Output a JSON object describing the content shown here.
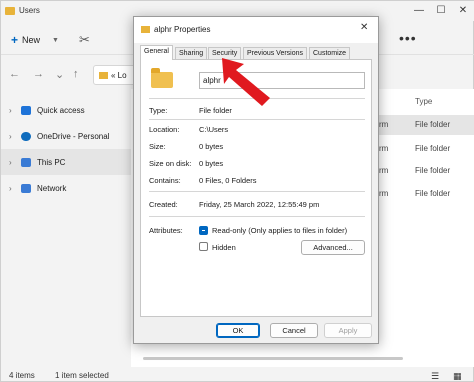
{
  "explorer": {
    "title": "Users",
    "toolbar": {
      "new_label": "New"
    },
    "address_text": "« Lo",
    "sidebar": [
      {
        "label": "Quick access",
        "icon": "star-icon",
        "color": "#1e73d8"
      },
      {
        "label": "OneDrive - Personal",
        "icon": "cloud-icon",
        "color": "#0f6cbd"
      },
      {
        "label": "This PC",
        "icon": "computer-icon",
        "color": "#3a7bd5",
        "selected": true
      },
      {
        "label": "Network",
        "icon": "network-icon",
        "color": "#3a7bd5"
      }
    ],
    "column_header": "Type",
    "rows": [
      {
        "left": "rm",
        "type": "File folder"
      },
      {
        "left": "rm",
        "type": "File folder"
      },
      {
        "left": "rm",
        "type": "File folder"
      },
      {
        "left": "rm",
        "type": "File folder"
      }
    ],
    "status": {
      "items": "4 items",
      "selected": "1 item selected"
    }
  },
  "dialog": {
    "title": "alphr Properties",
    "tabs": [
      "General",
      "Sharing",
      "Security",
      "Previous Versions",
      "Customize"
    ],
    "active_tab": "General",
    "name_value": "alphr",
    "fields": {
      "type_label": "Type:",
      "type_value": "File folder",
      "location_label": "Location:",
      "location_value": "C:\\Users",
      "size_label": "Size:",
      "size_value": "0 bytes",
      "size_on_disk_label": "Size on disk:",
      "size_on_disk_value": "0 bytes",
      "contains_label": "Contains:",
      "contains_value": "0 Files, 0 Folders",
      "created_label": "Created:",
      "created_value": "Friday, 25 March 2022, 12:55:49 pm",
      "attributes_label": "Attributes:"
    },
    "readonly_label": "Read-only (Only applies to files in folder)",
    "readonly_checked": true,
    "hidden_label": "Hidden",
    "hidden_checked": false,
    "advanced_label": "Advanced...",
    "buttons": {
      "ok": "OK",
      "cancel": "Cancel",
      "apply": "Apply"
    }
  },
  "colors": {
    "accent": "#0067c0",
    "arrow": "#e0191f",
    "folder": "#f0c050"
  }
}
